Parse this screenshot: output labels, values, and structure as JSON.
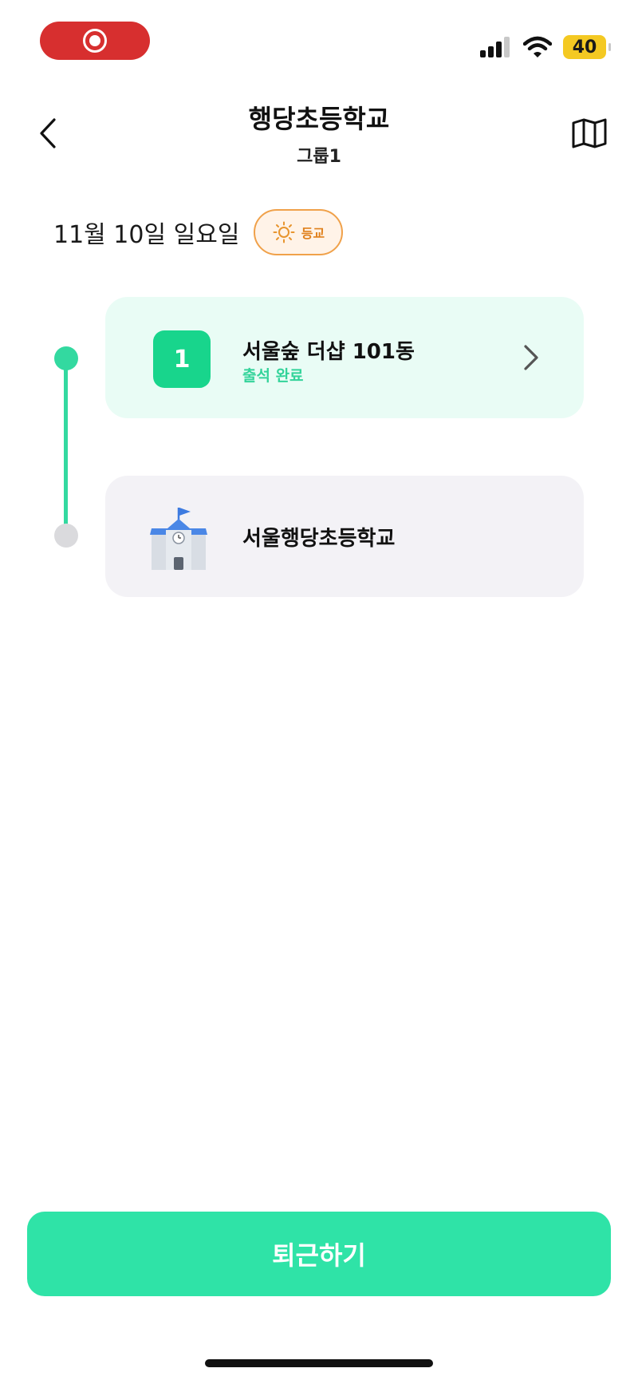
{
  "status_bar": {
    "battery": "40",
    "icons": [
      "screen-record-icon",
      "signal-icon",
      "wifi-icon",
      "battery-icon"
    ]
  },
  "header": {
    "title": "행당초등학교",
    "subtitle": "그룹1",
    "back_icon": "chevron-left-icon",
    "map_icon": "map-icon"
  },
  "date_row": {
    "date": "11월 10일 일요일",
    "trip_chip": {
      "icon": "sun-icon",
      "label": "등교"
    }
  },
  "stops": [
    {
      "number": "1",
      "name": "서울숲 더샵 101동",
      "status": "출석 완료"
    }
  ],
  "destination": {
    "name": "서울행당초등학교",
    "icon": "school-icon"
  },
  "footer": {
    "primary_button": "퇴근하기"
  },
  "colors": {
    "accent": "#2FE3A7",
    "badge_green": "#18D58C",
    "chip_orange": "#F0A14A",
    "record_red": "#D72F2F",
    "battery_yellow": "#F4C922"
  }
}
